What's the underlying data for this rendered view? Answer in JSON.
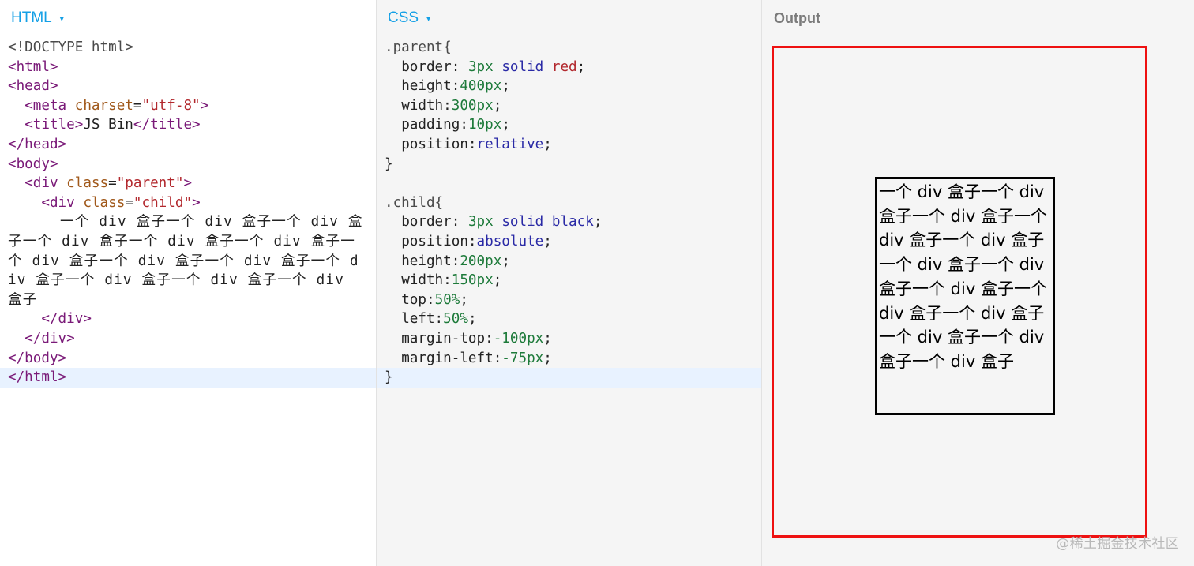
{
  "panes": {
    "html": {
      "title": "HTML",
      "caret": "▾"
    },
    "css": {
      "title": "CSS",
      "caret": "▾"
    },
    "output": {
      "title": "Output"
    }
  },
  "html_code": {
    "l1": "<!DOCTYPE html>",
    "l2": "<html>",
    "l3": "<head>",
    "l4_open": "<meta ",
    "l4_attr": "charset",
    "l4_eq": "=",
    "l4_val": "\"utf-8\"",
    "l4_close": ">",
    "l5_open": "<title>",
    "l5_text": "JS Bin",
    "l5_close": "</title>",
    "l6": "</head>",
    "l7": "<body>",
    "l8_open": "<div ",
    "l8_attr": "class",
    "l8_eq": "=",
    "l8_val": "\"parent\"",
    "l8_close": ">",
    "l9_open": "<div ",
    "l9_attr": "class",
    "l9_eq": "=",
    "l9_val": "\"child\"",
    "l9_close": ">",
    "text": "一个 div 盒子一个 div 盒子一个 div 盒子一个 div 盒子一个 div 盒子一个 div 盒子一个 div 盒子一个 div 盒子一个 div 盒子一个 div 盒子一个 div 盒子一个 div 盒子一个 div 盒子",
    "l11": "</div>",
    "l12": "</div>",
    "l13": "</body>",
    "l14": "</html>"
  },
  "css_code": {
    "parent_sel": ".parent{",
    "p1_prop": "border: ",
    "p1_num": "3px",
    "p1_kw": "solid",
    "p1_red": "red",
    "p2_prop": "height:",
    "p2_num": "400px",
    "p3_prop": "width:",
    "p3_num": "300px",
    "p4_prop": "padding:",
    "p4_num": "10px",
    "p5_prop": "position:",
    "p5_kw": "relative",
    "close1": "}",
    "child_sel": ".child{",
    "c1_prop": "border: ",
    "c1_num": "3px",
    "c1_kw": "solid",
    "c1_kw2": "black",
    "c2_prop": "position:",
    "c2_kw": "absolute",
    "c3_prop": "height:",
    "c3_num": "200px",
    "c4_prop": "width:",
    "c4_num": "150px",
    "c5_prop": "top:",
    "c5_num": "50%",
    "c6_prop": "left:",
    "c6_num": "50%",
    "c7_prop": "margin-top:",
    "c7_num": "-100px",
    "c8_prop": "margin-left:",
    "c8_num": "-75px",
    "close2": "}"
  },
  "output": {
    "child_text": "一个 div 盒子一个 div 盒子一个 div 盒子一个 div 盒子一个 div 盒子一个 div 盒子一个 div 盒子一个 div 盒子一个 div 盒子一个 div 盒子一个 div 盒子一个 div 盒子一个 div 盒子"
  },
  "watermark": "@稀土掘金技术社区",
  "colors": {
    "accent": "#14a0e6",
    "parent_border": "#ee1111",
    "child_border": "#000000"
  }
}
